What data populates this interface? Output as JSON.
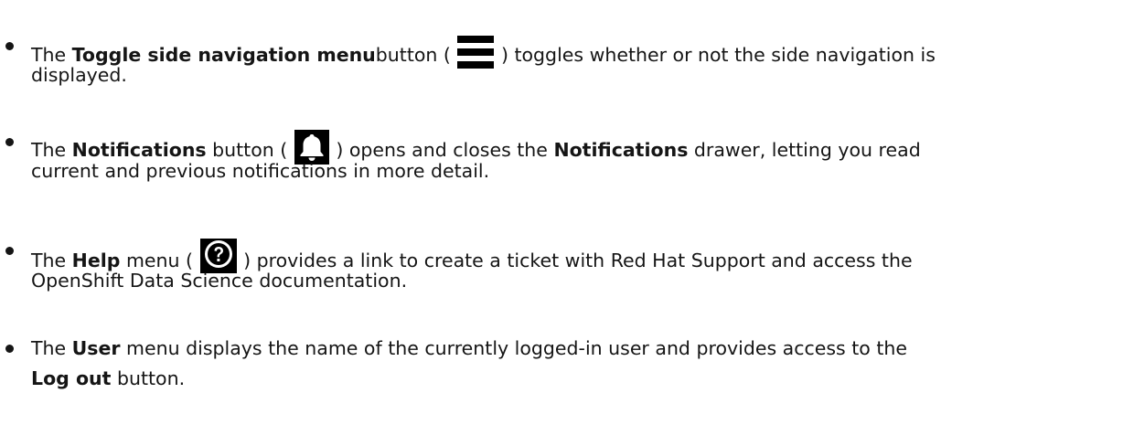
{
  "items": [
    {
      "line1": {
        "pre": "The ",
        "bold": "Toggle side navigation menu",
        "mid": "button ( ",
        "post": " ) toggles whether or not the side navigation is"
      },
      "line2": "displayed.",
      "icon": "menu-icon"
    },
    {
      "line1": {
        "pre": "The ",
        "bold": "Notifications",
        "mid": " button ( ",
        "post": " ) opens and closes the ",
        "bold2": "Notifications",
        "post2": " drawer, letting you read"
      },
      "line2": "current and previous notifications in more detail.",
      "icon": "bell-icon"
    },
    {
      "line1": {
        "pre": "The ",
        "bold": "Help",
        "mid": " menu ( ",
        "post": " ) provides a link to create a ticket with Red Hat Support and access the"
      },
      "line2": "OpenShift Data Science documentation.",
      "icon": "help-icon"
    },
    {
      "line1": {
        "pre": "The ",
        "bold": "User",
        "post": " menu displays the name of the currently logged-in user and provides access to the"
      },
      "line2": {
        "bold": "Log out",
        "post": " button."
      }
    }
  ]
}
